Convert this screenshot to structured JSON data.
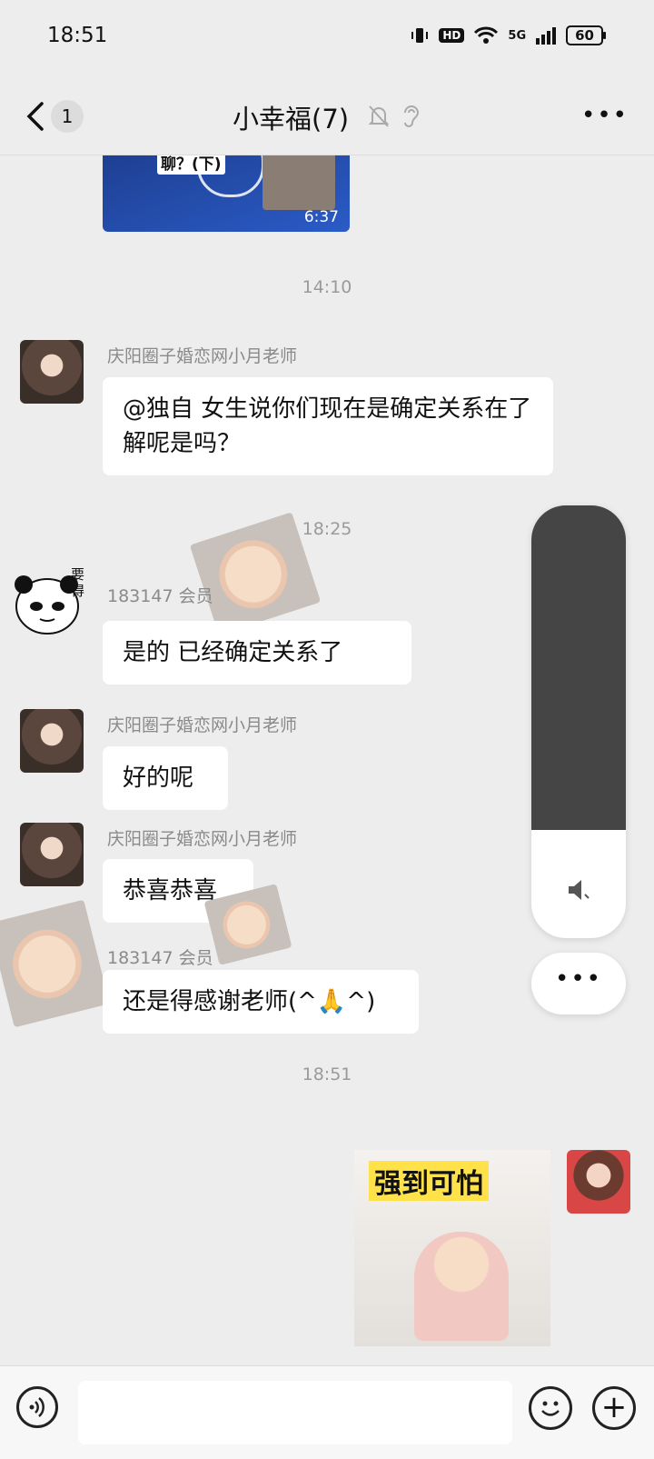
{
  "status_bar": {
    "time": "18:51",
    "hd": "HD",
    "network": "5G",
    "battery": "60"
  },
  "nav": {
    "unread_count": "1",
    "title": "小幸福(7)",
    "icons": [
      "back-icon",
      "mute-bell-icon",
      "ear-icon",
      "more-icon"
    ]
  },
  "chat": {
    "video": {
      "thumb_text": "聊？(下)",
      "duration": "6:37"
    },
    "time_14_10": "14:10",
    "msg1": {
      "sender": "庆阳圈子婚恋网小月老师",
      "text": "@独自  女生说你们现在是确定关系在了解呢是吗？"
    },
    "time_18_25": "18:25",
    "msg2": {
      "sender": "183147  会员",
      "text": "是的  已经确定关系了"
    },
    "msg3": {
      "sender": "庆阳圈子婚恋网小月老师",
      "text": "好的呢"
    },
    "msg4": {
      "sender": "庆阳圈子婚恋网小月老师",
      "text": "恭喜恭喜"
    },
    "msg5": {
      "sender": "183147  会员",
      "text": "还是得感谢老师(^🙏^)"
    },
    "time_18_51": "18:51",
    "sticker": {
      "text": "强到可怕"
    },
    "panda_text": "要得"
  },
  "volume_panel": {
    "level": 0.75,
    "icons": [
      "speaker-icon",
      "more-icon"
    ]
  },
  "input_bar": {
    "icons": [
      "voice-icon",
      "emoji-icon",
      "plus-icon"
    ],
    "value": ""
  }
}
